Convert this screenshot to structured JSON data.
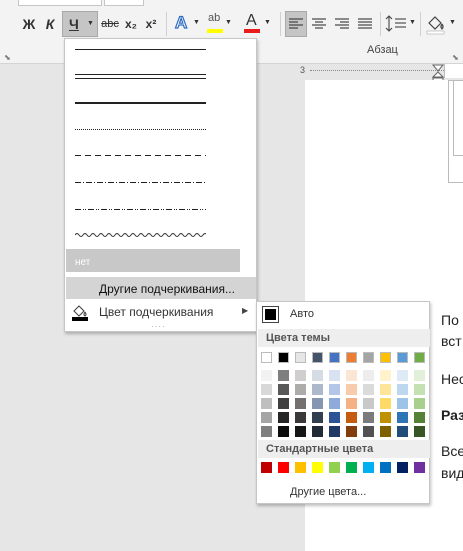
{
  "ribbon": {
    "bold_label": "Ж",
    "italic_label": "К",
    "underline_label": "Ч",
    "strikethrough_label": "abc",
    "subscript_label": "x₂",
    "superscript_label": "x²",
    "font_color_label": "A",
    "paragraph_group_label": "Абзац"
  },
  "ruler": {
    "number": "3"
  },
  "underline_menu": {
    "none_label": "нет",
    "other_underlines": "Другие подчеркивания...",
    "underline_color": "Цвет подчеркивания"
  },
  "color_menu": {
    "auto_label": "Авто",
    "theme_colors_header": "Цвета темы",
    "standard_colors_header": "Стандартные цвета",
    "more_colors": "Другие цвета...",
    "theme_top_row": [
      "#ffffff",
      "#000000",
      "#e7e6e6",
      "#44546a",
      "#4472c4",
      "#ed7d31",
      "#a5a5a5",
      "#ffc000",
      "#5b9bd5",
      "#70ad47"
    ],
    "theme_shades": [
      [
        "#f2f2f2",
        "#7f7f7f",
        "#d0cece",
        "#d6dce4",
        "#d9e2f3",
        "#fbe5d5",
        "#ededed",
        "#fff2cc",
        "#deebf6",
        "#e2efd9"
      ],
      [
        "#d8d8d8",
        "#595959",
        "#aeabab",
        "#adb9ca",
        "#b4c6e7",
        "#f7cbac",
        "#dbdbdb",
        "#fee599",
        "#bdd7ee",
        "#c5e0b3"
      ],
      [
        "#bfbfbf",
        "#3f3f3f",
        "#757070",
        "#8496b0",
        "#8eaadb",
        "#f4b183",
        "#c9c9c9",
        "#ffd965",
        "#9dc3e6",
        "#a8d08d"
      ],
      [
        "#a5a5a5",
        "#262626",
        "#3a3838",
        "#323f4f",
        "#2f5496",
        "#c55a11",
        "#7b7b7b",
        "#bf9000",
        "#2e75b5",
        "#538135"
      ],
      [
        "#7f7f7f",
        "#0c0c0c",
        "#171616",
        "#222a35",
        "#1f3864",
        "#833c0b",
        "#525252",
        "#7f6000",
        "#1e4e79",
        "#375623"
      ]
    ],
    "standard": [
      "#c00000",
      "#ff0000",
      "#ffc000",
      "#ffff00",
      "#92d050",
      "#00b050",
      "#00b0f0",
      "#0070c0",
      "#002060",
      "#7030a0"
    ]
  },
  "document": {
    "lines": [
      "По",
      "вст",
      "Нес",
      "Раз",
      "Все",
      "вид"
    ]
  }
}
